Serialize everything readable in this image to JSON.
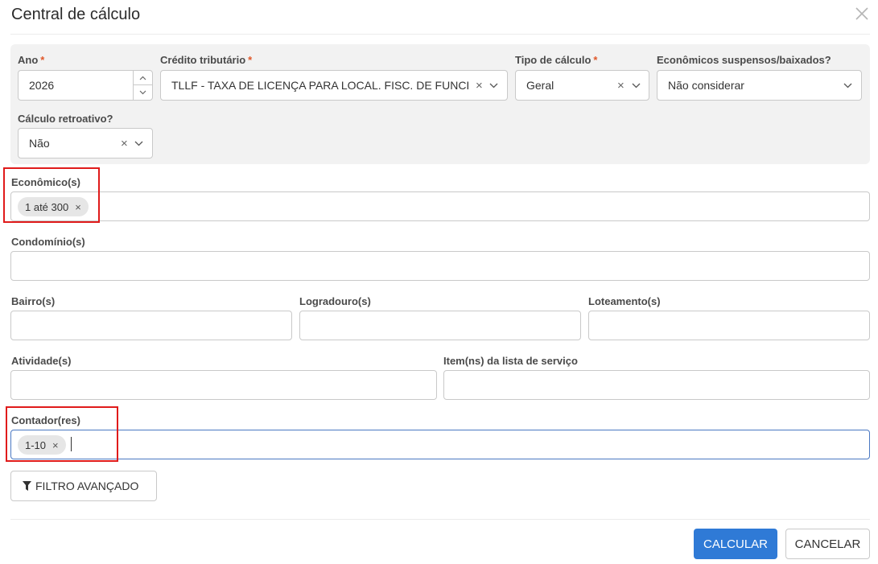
{
  "dialog": {
    "title": "Central de cálculo",
    "close_icon": "close-icon"
  },
  "required_marker": "*",
  "fields": {
    "ano": {
      "label": "Ano",
      "value": "2026",
      "required": true
    },
    "credito_tributario": {
      "label": "Crédito tributário",
      "value": "TLLF - TAXA DE LICENÇA PARA LOCAL. FISC. DE FUNCI...",
      "required": true
    },
    "tipo_calculo": {
      "label": "Tipo de cálculo",
      "value": "Geral",
      "required": true
    },
    "economicos_suspensos": {
      "label": "Econômicos suspensos/baixados?",
      "value": "Não considerar"
    },
    "calculo_retroativo": {
      "label": "Cálculo retroativo?",
      "value": "Não"
    },
    "economicos": {
      "label": "Econômico(s)",
      "chips": [
        "1 até 300"
      ]
    },
    "condominios": {
      "label": "Condomínio(s)",
      "value": ""
    },
    "bairros": {
      "label": "Bairro(s)",
      "value": ""
    },
    "logradouros": {
      "label": "Logradouro(s)",
      "value": ""
    },
    "loteamentos": {
      "label": "Loteamento(s)",
      "value": ""
    },
    "atividades": {
      "label": "Atividade(s)",
      "value": ""
    },
    "itens_servico": {
      "label": "Item(ns) da lista de serviço",
      "value": ""
    },
    "contadores": {
      "label": "Contador(res)",
      "chips": [
        "1-10"
      ]
    }
  },
  "chip_remove_glyph": "×",
  "clear_glyph": "×",
  "buttons": {
    "advanced_filter": "FILTRO AVANÇADO",
    "calculate": "CALCULAR",
    "cancel": "CANCELAR"
  },
  "colors": {
    "primary": "#2f7ad6",
    "required": "#e0582a",
    "highlight": "#e01b1b",
    "panel": "#f2f2f2"
  }
}
